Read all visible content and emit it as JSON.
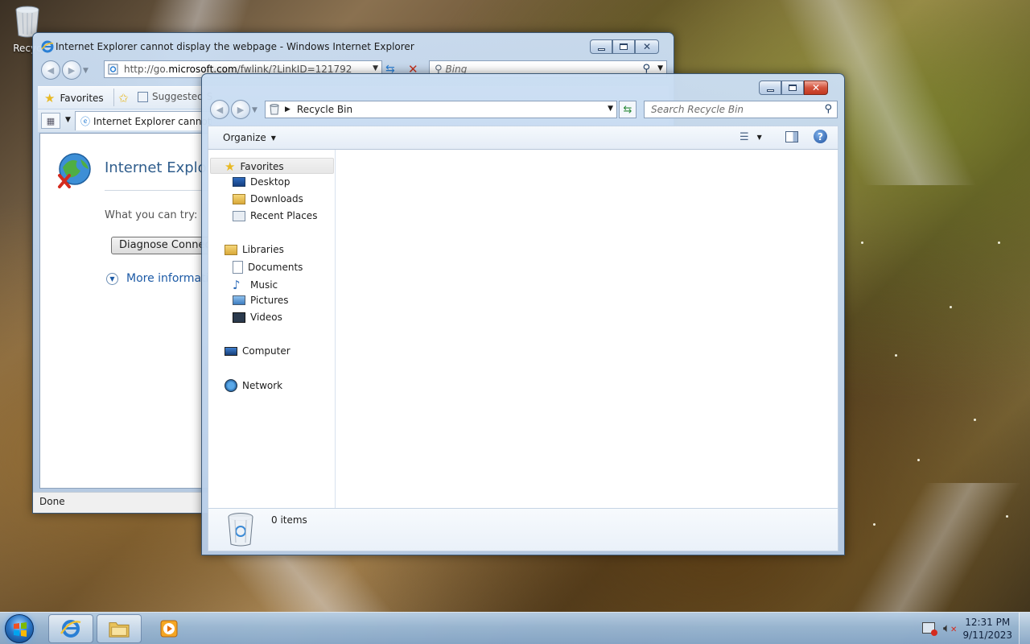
{
  "desktop": {
    "recycle_icon_label": "Recyc"
  },
  "ie_window": {
    "title": "Internet Explorer cannot display the webpage - Windows Internet Explorer",
    "address_prefix": "http://go.",
    "address_domain": "microsoft.com",
    "address_suffix": "/fwlink/?LinkID=121792",
    "search_placeholder": "Bing",
    "favorites_label": "Favorites",
    "suggested_label": "Suggested S",
    "tab_label": "Internet Explorer cannot ...",
    "heading": "Internet Explore",
    "what_you_can_try": "What you can try:",
    "diagnose_button": "Diagnose Connect",
    "more_info": "More informati",
    "status": "Done"
  },
  "explorer_window": {
    "breadcrumb": "Recycle Bin",
    "search_placeholder": "Search Recycle Bin",
    "organize_label": "Organize",
    "nav": {
      "favorites": "Favorites",
      "desktop": "Desktop",
      "downloads": "Downloads",
      "recent_places": "Recent Places",
      "libraries": "Libraries",
      "documents": "Documents",
      "music": "Music",
      "pictures": "Pictures",
      "videos": "Videos",
      "computer": "Computer",
      "network": "Network"
    },
    "item_count": "0 items"
  },
  "taskbar": {
    "time": "12:31 PM",
    "date": "9/11/2023",
    "pinned": [
      "internet-explorer",
      "windows-explorer",
      "media-player"
    ]
  },
  "colors": {
    "link_blue": "#1c5aa6",
    "heading_blue": "#2f5d8c",
    "close_red": "#c2381f"
  }
}
